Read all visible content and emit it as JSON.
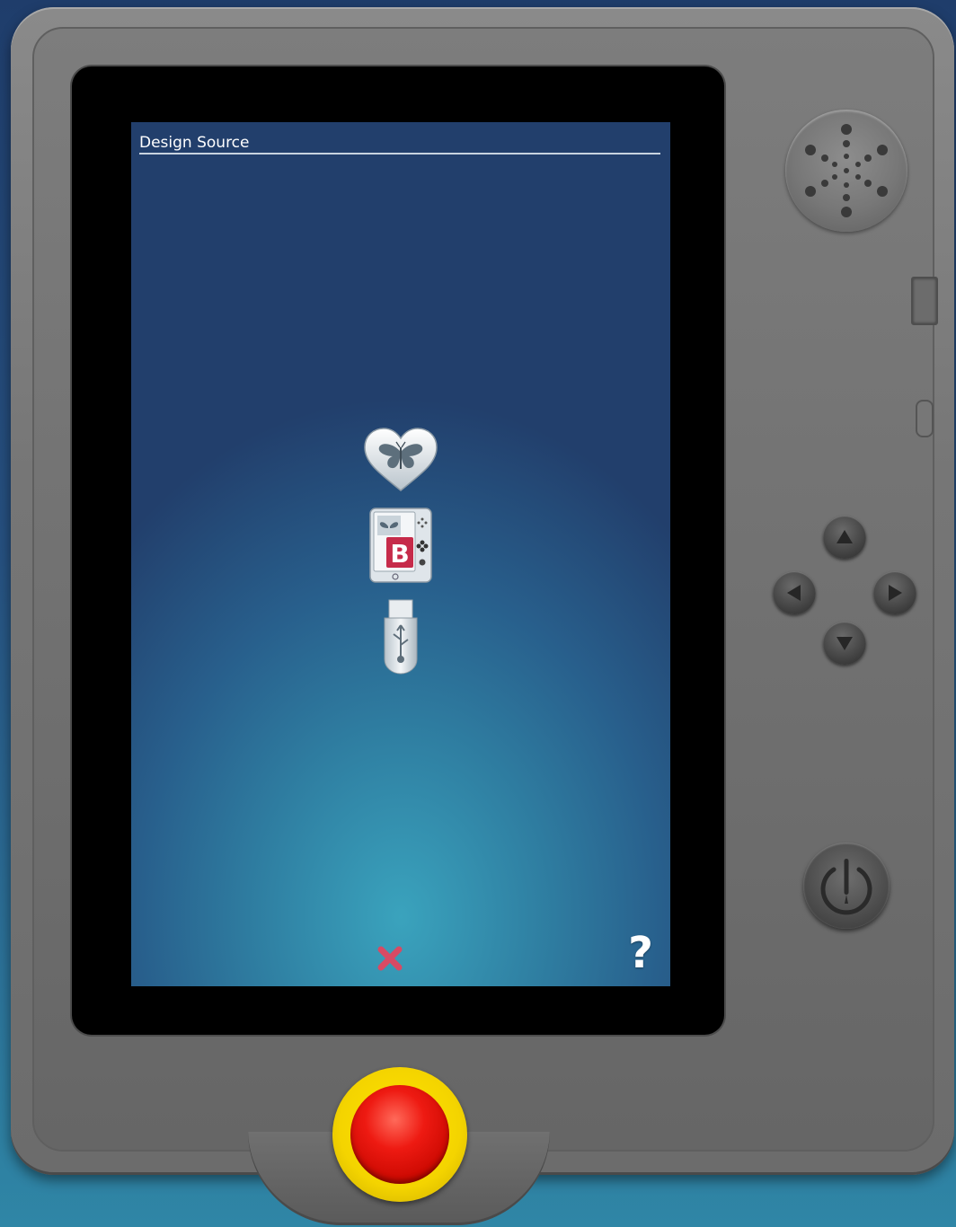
{
  "screen": {
    "title": "Design Source",
    "sources": [
      {
        "name": "favorites",
        "icon": "heart-butterfly-icon"
      },
      {
        "name": "designs",
        "icon": "machine-design-icon",
        "badge": "B"
      },
      {
        "name": "usb",
        "icon": "usb-drive-icon"
      }
    ],
    "close_icon": "close-icon",
    "help_label": "?"
  },
  "hardware": {
    "dpad": [
      "up",
      "left",
      "right",
      "down"
    ],
    "power_icon": "needle-power-icon",
    "stop_color": "#e81c10",
    "stop_ring_color": "#f3d400"
  },
  "colors": {
    "accent_close": "#d84a64",
    "title_text": "#ffffff"
  }
}
